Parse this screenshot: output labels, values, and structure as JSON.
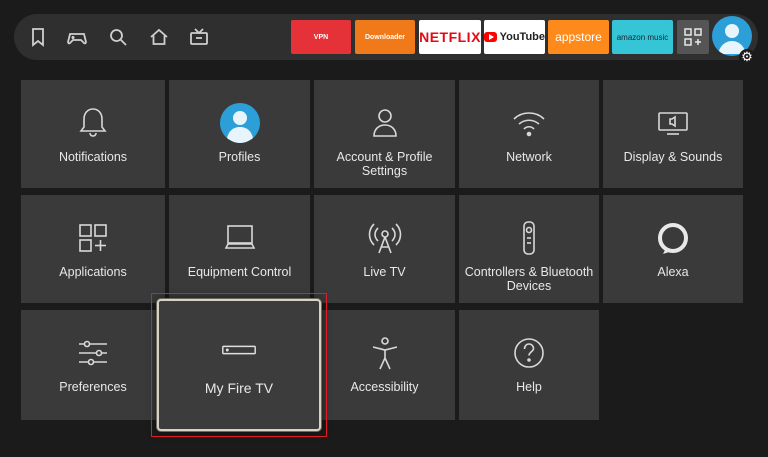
{
  "nav": {
    "icons": [
      "bookmark-icon",
      "gamepad-icon",
      "search-icon",
      "home-icon",
      "live-tv-icon"
    ]
  },
  "apps": [
    {
      "label": "VPN",
      "bg": "#e53238",
      "fg": "#ffffff"
    },
    {
      "label": "Downloader",
      "bg": "#f07a1a",
      "fg": "#ffffff"
    },
    {
      "label": "NETFLIX",
      "bg": "#ffffff",
      "fg": "#e50914"
    },
    {
      "label": "YouTube",
      "bg": "#ffffff",
      "fg": "#222222"
    },
    {
      "label": "appstore",
      "bg": "#ff8a1c",
      "fg": "#ffffff"
    },
    {
      "label": "amazon music",
      "bg": "#36c5d6",
      "fg": "#1b2330"
    }
  ],
  "tiles": [
    {
      "label": "Notifications",
      "icon": "bell-icon"
    },
    {
      "label": "Profiles",
      "icon": "profile-avatar-icon"
    },
    {
      "label": "Account & Profile Settings",
      "icon": "person-icon"
    },
    {
      "label": "Network",
      "icon": "wifi-icon"
    },
    {
      "label": "Display & Sounds",
      "icon": "tv-sound-icon"
    },
    {
      "label": "Applications",
      "icon": "apps-grid-icon"
    },
    {
      "label": "Equipment Control",
      "icon": "monitor-icon"
    },
    {
      "label": "Live TV",
      "icon": "antenna-icon"
    },
    {
      "label": "Controllers & Bluetooth Devices",
      "icon": "remote-icon"
    },
    {
      "label": "Alexa",
      "icon": "alexa-icon"
    },
    {
      "label": "Preferences",
      "icon": "sliders-icon"
    },
    {
      "label": "My Fire TV",
      "icon": "fire-tv-device-icon"
    },
    {
      "label": "Accessibility",
      "icon": "accessibility-icon"
    },
    {
      "label": "Help",
      "icon": "help-icon"
    }
  ],
  "colors": {
    "accent_blue": "#2d9fd8",
    "focus_highlight": "#e01b24"
  }
}
